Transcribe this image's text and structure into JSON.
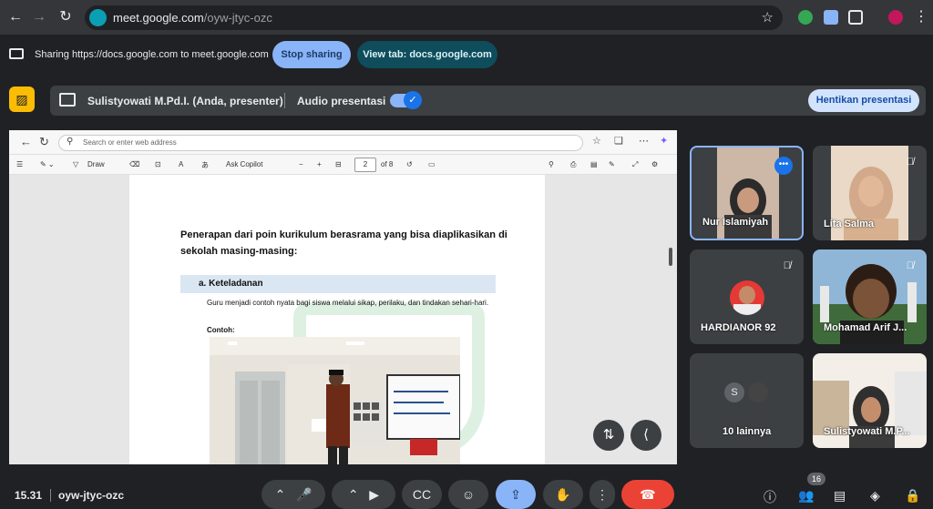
{
  "browser": {
    "url_host": "meet.google.com",
    "url_path": "/oyw-jtyc-ozc"
  },
  "sharebar": {
    "text": "Sharing https://docs.google.com to meet.google.com",
    "stop_label": "Stop sharing",
    "view_tab_label": "View tab: docs.google.com"
  },
  "presenter": {
    "name": "Sulistyowati M.Pd.I. (Anda, presenter)",
    "audio_label": "Audio presentasi",
    "audio_on": true,
    "stop_label": "Hentikan presentasi"
  },
  "shared_window": {
    "address_placeholder": "Search or enter web address",
    "toolbar": {
      "draw": "Draw",
      "ask": "Ask Copilot",
      "page_current": "2",
      "page_total": "of 8"
    },
    "doc": {
      "heading_line1": "Penerapan dari poin kurikulum berasrama yang bisa diaplikasikan di",
      "heading_line2": "sekolah masing-masing:",
      "section_title": "a.  Keteladanan",
      "section_body": "Guru menjadi contoh nyata bagi siswa melalui sikap, perilaku, dan tindakan sehari-hari.",
      "contoh_label": "Contoh:"
    }
  },
  "participants": [
    {
      "name": "Nur Islamiyah",
      "active": true,
      "muted": false
    },
    {
      "name": "Lita Salma",
      "active": false,
      "muted": true
    },
    {
      "name": "HARDIANOR 92",
      "active": false,
      "muted": true
    },
    {
      "name": "Mohamad Arif J...",
      "active": false,
      "muted": true
    },
    {
      "name": "10 lainnya",
      "avatar_letter": "S"
    },
    {
      "name": "Sulistyowati M.P...",
      "active": false,
      "muted": false
    }
  ],
  "bottombar": {
    "time": "15.31",
    "meeting_code": "oyw-jtyc-ozc",
    "people_count": "16"
  },
  "colors": {
    "accent": "#8ab4f8",
    "end_call": "#ea4335",
    "present_active": "#8ab4f8"
  }
}
